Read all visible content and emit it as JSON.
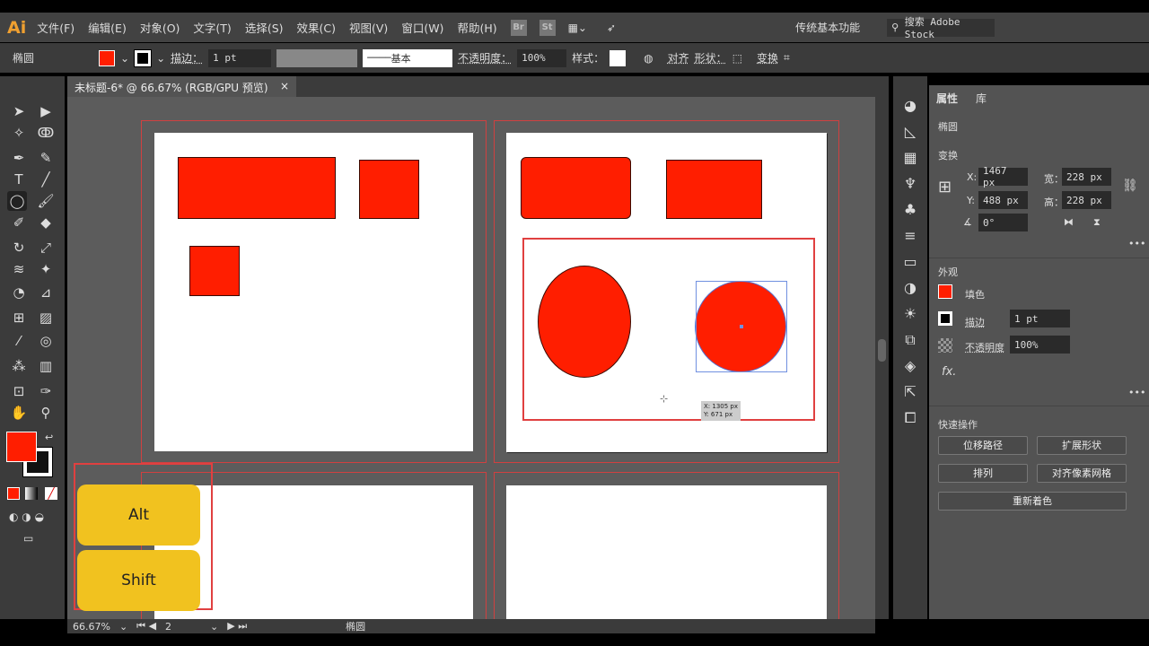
{
  "app": {
    "logo": "Ai",
    "menus": [
      "文件(F)",
      "编辑(E)",
      "对象(O)",
      "文字(T)",
      "选择(S)",
      "效果(C)",
      "视图(V)",
      "窗口(W)",
      "帮助(H)"
    ],
    "badges": [
      "Br",
      "St"
    ],
    "workspace": "传统基本功能",
    "search_placeholder": "搜索 Adobe Stock"
  },
  "control": {
    "object_type": "椭圆",
    "fill_color": "#ff1e00",
    "stroke_label": "描边：",
    "stroke_value": "1 pt",
    "brush_label": "基本",
    "opacity_label": "不透明度：",
    "opacity_value": "100%",
    "style_label": "样式：",
    "align_label": "对齐",
    "shape_label": "形状：",
    "transform_label": "变换"
  },
  "document": {
    "tab_title": "未标题-6* @ 66.67% (RGB/GPU 预览)",
    "close": "×"
  },
  "canvas": {
    "tooltip_x": "X: 1305 px",
    "tooltip_y": "Y: 671 px",
    "shape_color": "#ff1e00"
  },
  "overlay_keys": [
    "Alt",
    "Shift"
  ],
  "status": {
    "zoom": "66.67%",
    "artboard": "2",
    "tool": "椭圆"
  },
  "panel": {
    "tabs": [
      "属性",
      "库"
    ],
    "selection": "椭圆",
    "transform_title": "变换",
    "x_label": "X:",
    "x": "1467 px",
    "y_label": "Y:",
    "y": "488 px",
    "w_label": "宽：",
    "w": "228 px",
    "h_label": "高：",
    "h": "228 px",
    "angle": "0°",
    "appearance_title": "外观",
    "fill_label": "填色",
    "stroke_label": "描边",
    "stroke_value": "1 pt",
    "opacity_label": "不透明度",
    "opacity_value": "100%",
    "fx": "fx.",
    "quick_title": "快速操作",
    "buttons": [
      "位移路径",
      "扩展形状",
      "排列",
      "对齐像素网格",
      "重新着色"
    ]
  }
}
